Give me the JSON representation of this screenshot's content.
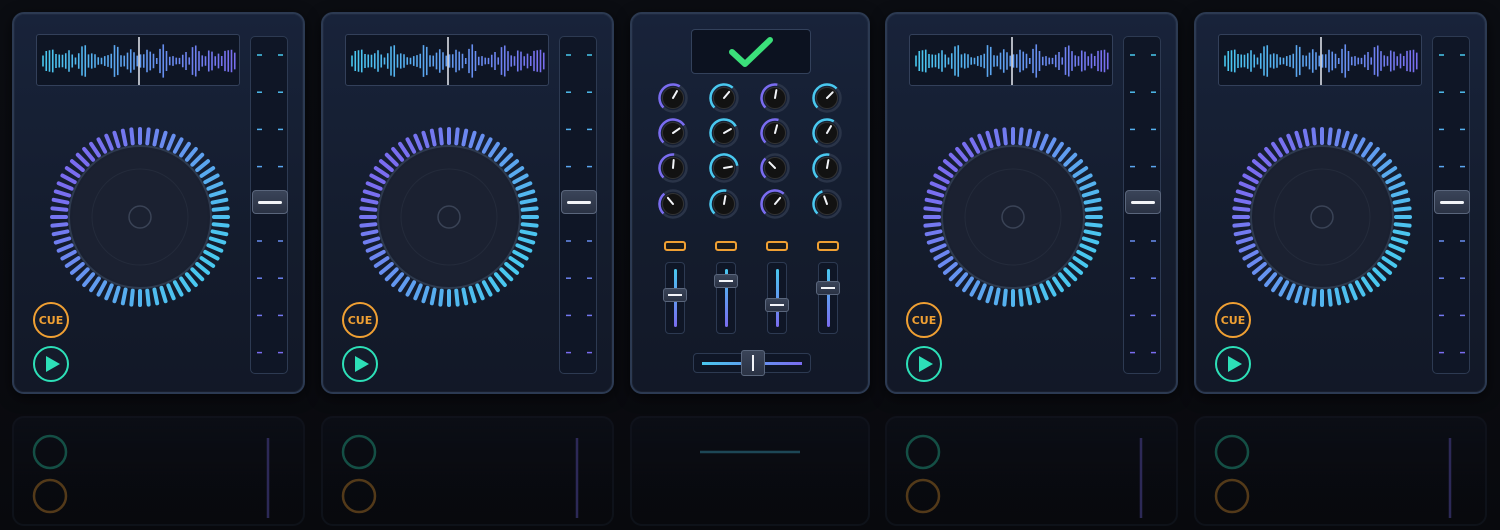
{
  "decks": [
    {
      "id": "deck-1",
      "cue_label": "CUE",
      "pitch_position": 0.48,
      "play_icon": "play-icon"
    },
    {
      "id": "deck-2",
      "cue_label": "CUE",
      "pitch_position": 0.48,
      "play_icon": "play-icon"
    },
    {
      "id": "deck-3",
      "cue_label": "CUE",
      "pitch_position": 0.48,
      "play_icon": "play-icon"
    },
    {
      "id": "deck-4",
      "cue_label": "CUE",
      "pitch_position": 0.48,
      "play_icon": "play-icon"
    }
  ],
  "mixer": {
    "status_icon": "checkmark-icon",
    "knob_angles": [
      [
        30,
        40,
        10,
        45
      ],
      [
        55,
        60,
        15,
        30
      ],
      [
        5,
        80,
        -45,
        10
      ],
      [
        -40,
        10,
        40,
        -20
      ]
    ],
    "channel_faders": [
      0.45,
      0.2,
      0.62,
      0.32
    ],
    "crossfader": 0.5
  },
  "colors": {
    "accent_cyan": "#49c8ef",
    "accent_purple": "#7a6cf0",
    "cue_orange": "#f0a033",
    "play_green": "#2de0b8",
    "check_green": "#3be07a"
  }
}
